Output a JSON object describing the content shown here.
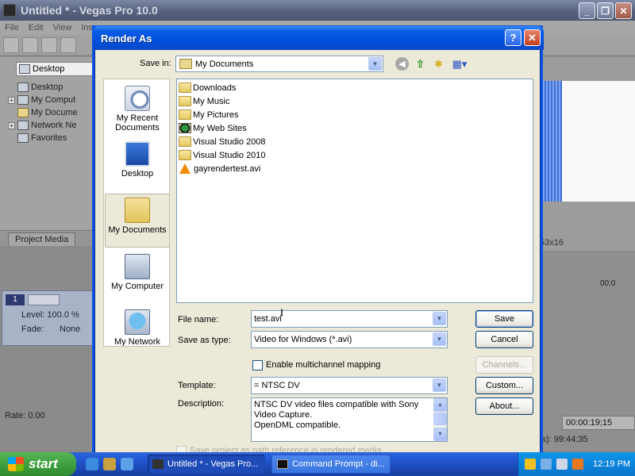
{
  "app": {
    "title": "Untitled * - Vegas Pro 10.0",
    "menu": [
      "File",
      "Edit",
      "View",
      "Inse"
    ],
    "explorer": {
      "location": "Desktop",
      "tree": [
        {
          "label": "Desktop",
          "expander": ""
        },
        {
          "label": "My Comput",
          "expander": "+"
        },
        {
          "label": "My Docume",
          "expander": ""
        },
        {
          "label": "Network Ne",
          "expander": "+"
        },
        {
          "label": "Favorites",
          "expander": ""
        }
      ]
    },
    "tab_project_media": "Project Media",
    "track": {
      "number": "1",
      "level": "Level: 100.0 %",
      "fade_label": "Fade:",
      "fade_value": "None"
    },
    "rate": "Rate: 0.00",
    "preview_res": "53x16",
    "ruler_time": "00:0",
    "timecode": "00:00:19;15",
    "total_time": "ls): 99:44:35"
  },
  "dialog": {
    "title": "Render As",
    "help_label": "?",
    "close_label": "✕",
    "save_in_label": "Save in:",
    "save_in_value": "My Documents",
    "places": [
      {
        "label": "My Recent Documents",
        "icon": "recent-documents-icon"
      },
      {
        "label": "Desktop",
        "icon": "desktop-icon"
      },
      {
        "label": "My Documents",
        "icon": "my-documents-icon"
      },
      {
        "label": "My Computer",
        "icon": "my-computer-icon"
      },
      {
        "label": "My Network",
        "icon": "my-network-icon"
      }
    ],
    "files": [
      {
        "name": "Downloads",
        "type": "folder"
      },
      {
        "name": "My Music",
        "type": "folder"
      },
      {
        "name": "My Pictures",
        "type": "folder"
      },
      {
        "name": "My Web Sites",
        "type": "web"
      },
      {
        "name": "Visual Studio 2008",
        "type": "folder"
      },
      {
        "name": "Visual Studio 2010",
        "type": "folder"
      },
      {
        "name": "gayrendertest.avi",
        "type": "vlc"
      }
    ],
    "file_name_label": "File name:",
    "file_name_value": "test.avi",
    "save_as_type_label": "Save as type:",
    "save_as_type_value": "Video for Windows (*.avi)",
    "save_button": "Save",
    "cancel_button": "Cancel",
    "multichannel_label": "Enable multichannel mapping",
    "channels_button": "Channels...",
    "template_label": "Template:",
    "template_value": "= NTSC DV",
    "custom_button": "Custom...",
    "description_label": "Description:",
    "description_lines": [
      "NTSC DV video files compatible with Sony",
      "Video Capture.",
      "OpenDML compatible."
    ],
    "about_button": "About...",
    "save_path_label": "Save project as path reference in rendered media"
  },
  "taskbar": {
    "start_label": "start",
    "items": [
      {
        "label": "Untitled * - Vegas Pro...",
        "active": true
      },
      {
        "label": "Command Prompt - di...",
        "active": false
      }
    ],
    "clock": "12:19 PM"
  },
  "colors": {
    "xp_blue": "#0050dc",
    "start_green": "#3c9c3c",
    "vlc_orange": "#f08a00"
  }
}
